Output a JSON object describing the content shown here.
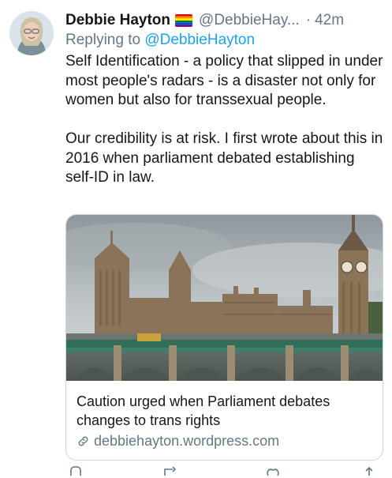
{
  "tweet": {
    "author_name": "Debbie Hayton",
    "handle": "@DebbieHay...",
    "separator": "·",
    "time": "42m",
    "replying_prefix": "Replying to ",
    "replying_to": "@DebbieHayton",
    "paragraphs": [
      "Self Identification - a policy that slipped in under most people's radars - is a disaster not only for women but also for transsexual people.",
      "Our credibility is at risk. I first wrote about this in 2016 when parliament debated establishing self-ID in law."
    ]
  },
  "card": {
    "title": "Caution urged when Parliament debates changes to trans rights",
    "domain": "debbiehayton.wordpress.com"
  },
  "icons": {
    "flag": "rainbow-flag-icon",
    "link": "link-icon",
    "reply": "reply-icon",
    "retweet": "retweet-icon",
    "like": "like-icon",
    "share": "share-icon"
  },
  "colors": {
    "accent": "#1da1f2",
    "secondary_text": "#657786",
    "border": "#ccd6dd"
  }
}
